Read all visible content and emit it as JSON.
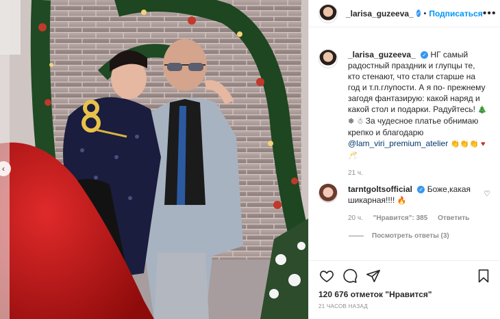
{
  "post": {
    "username": "_larisa_guzeeva_",
    "follow_label": "Подписаться",
    "separator": "•",
    "more_label": "•••"
  },
  "caption": {
    "username": "_larisa_guzeeva_",
    "text": "НГ самый радостный праздник и глупцы те, кто стенают, что стали старше на год и т.п.глупости. А я по- прежнему загодя фантазирую: какой наряд и какой стол и подарки. Радуйтесь!",
    "text2": "За чудесное платье обнимаю крепко и благодарю",
    "mention": "@lam_viri_premium_atelier",
    "time": "21 ч."
  },
  "comment": {
    "username": "tarntgoltsofficial",
    "text": "Боже,какая шикарная!!!!",
    "time": "20 ч.",
    "likes_label": "\"Нравится\": 385",
    "reply_label": "Ответить",
    "replies_label": "Посмотреть ответы (3)"
  },
  "footer": {
    "likes": "120 676 отметок \"Нравится\"",
    "timestamp": "21 ЧАСОВ НАЗАД"
  },
  "icons": [
    "heart-icon",
    "comment-icon",
    "share-icon",
    "bookmark-icon",
    "verified-icon",
    "more-icon",
    "chevron-left-icon"
  ],
  "colors": {
    "accent": "#0095f6",
    "verified": "#3897f0",
    "muted": "#8e8e8e"
  }
}
